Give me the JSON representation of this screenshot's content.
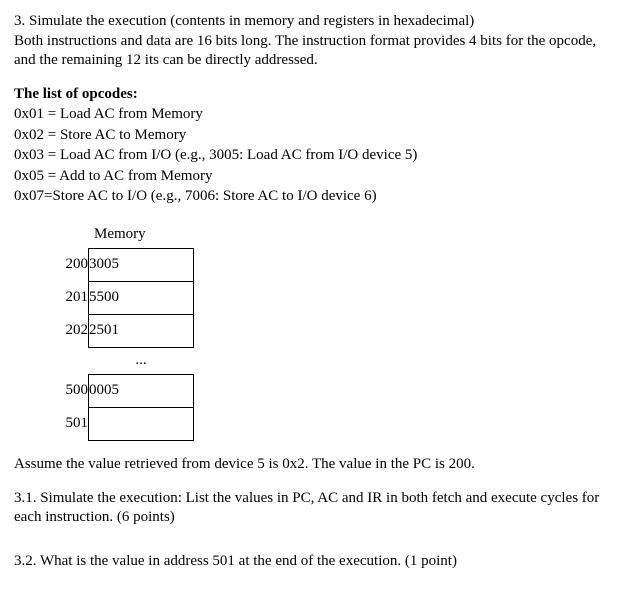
{
  "q3": {
    "prompt": "3. Simulate the execution (contents in memory and registers in hexadecimal)",
    "desc": "Both instructions and data are 16 bits long. The instruction format provides 4 bits for the opcode, and the remaining 12 its can be directly addressed."
  },
  "opcodes_title": "The list of opcodes:",
  "opcodes": [
    "0x01 = Load AC from Memory",
    "0x02 = Store AC to Memory",
    "0x03 = Load AC from I/O (e.g., 3005: Load AC from I/O device 5)",
    "0x05 = Add to AC from Memory",
    "0x07=Store AC to I/O (e.g., 7006: Store AC to I/O device 6)"
  ],
  "memory": {
    "label": "Memory",
    "rows1": [
      {
        "addr": "200",
        "val": "3005"
      },
      {
        "addr": "201",
        "val": "5500"
      },
      {
        "addr": "202",
        "val": "2501"
      }
    ],
    "dots": "...",
    "rows2": [
      {
        "addr": "500",
        "val": "0005"
      },
      {
        "addr": "501",
        "val": ""
      }
    ]
  },
  "assume": "Assume the value retrieved from device 5 is 0x2. The value in the PC is 200.",
  "q31": "3.1. Simulate the execution: List the values in PC, AC and IR in both fetch and execute cycles for each instruction. (6 points)",
  "q32": "3.2. What is the value in address 501 at the end of the execution. (1 point)"
}
